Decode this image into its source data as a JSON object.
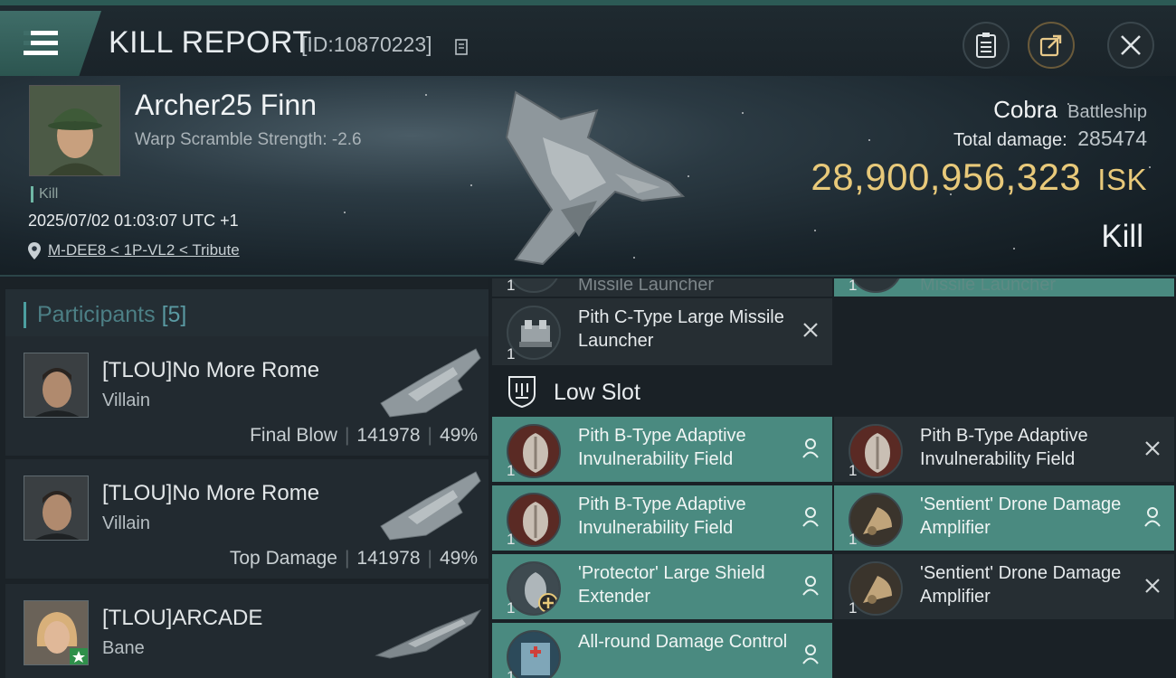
{
  "header": {
    "title": "KILL REPORT",
    "report_id": "[ID:10870223]"
  },
  "victim": {
    "name": "Archer25 Finn",
    "warp": "Warp Scramble Strength: -2.6",
    "tag": "Kill",
    "datetime": "2025/07/02 01:03:07 UTC +1",
    "location": "M-DEE8 < 1P-VL2 < Tribute"
  },
  "ship": {
    "name": "Cobra",
    "class": "Battleship",
    "total_damage_label": "Total damage:",
    "total_damage": "285474",
    "isk_value": "28,900,956,323",
    "isk_unit": "ISK",
    "result": "Kill"
  },
  "participants": {
    "title": "Participants",
    "count": "[5]",
    "rows": [
      {
        "name": "[TLOU]No More Rome",
        "ship": "Villain",
        "role": "Final Blow",
        "damage": "141978",
        "percent": "49%"
      },
      {
        "name": "[TLOU]No More Rome",
        "ship": "Villain",
        "role": "Top Damage",
        "damage": "141978",
        "percent": "49%"
      },
      {
        "name": "[TLOU]ARCADE",
        "ship": "Bane",
        "role": "",
        "damage": "",
        "percent": ""
      }
    ]
  },
  "fitting": {
    "top_partial": [
      {
        "name": "Missile Launcher",
        "qty": "1"
      },
      {
        "name": "Missile Launcher",
        "qty": "1"
      }
    ],
    "high_last": {
      "name": "Pith C-Type Large Missile Launcher",
      "qty": "1",
      "status": "destroyed"
    },
    "low_slot_label": "Low Slot",
    "low_slots": [
      {
        "name": "Pith B-Type Adaptive Invulnerability Field",
        "qty": "1",
        "status": "dropped"
      },
      {
        "name": "Pith B-Type Adaptive Invulnerability Field",
        "qty": "1",
        "status": "destroyed"
      },
      {
        "name": "Pith B-Type Adaptive Invulnerability Field",
        "qty": "1",
        "status": "dropped"
      },
      {
        "name": "'Sentient' Drone Damage Amplifier",
        "qty": "1",
        "status": "dropped"
      },
      {
        "name": "'Protector' Large Shield Extender",
        "qty": "1",
        "status": "dropped"
      },
      {
        "name": "'Sentient' Drone Damage Amplifier",
        "qty": "1",
        "status": "destroyed"
      },
      {
        "name": "All-round Damage Control",
        "qty": "1",
        "status": "dropped"
      }
    ]
  },
  "colors": {
    "accent": "#4a8a80",
    "isk": "#e8c97a",
    "bg": "#1a2128"
  }
}
